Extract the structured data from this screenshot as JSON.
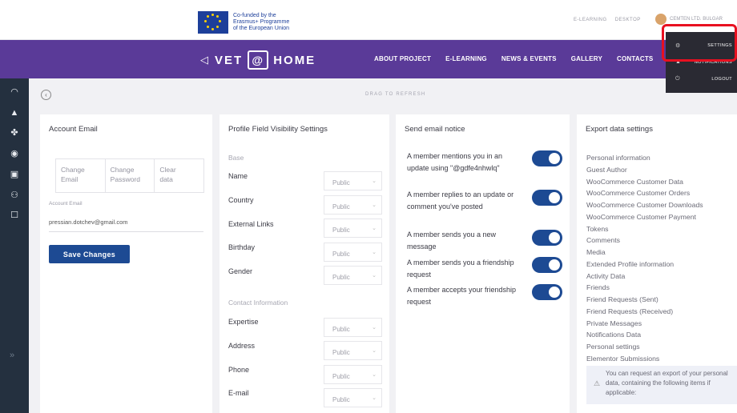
{
  "header": {
    "eu_text": [
      "Co-funded by the",
      "Erasmus+ Programme",
      "of the European Union"
    ],
    "top_links": [
      "E-LEARNING",
      "DESKTOP"
    ],
    "user_name": "CEMTEN LTD. BULGAR"
  },
  "nav": {
    "brand_left": "VET",
    "brand_at": "@",
    "brand_right": "HOME",
    "links": [
      "ABOUT PROJECT",
      "E-LEARNING",
      "NEWS & EVENTS",
      "GALLERY",
      "CONTACTS"
    ]
  },
  "dropdown": {
    "items": [
      {
        "icon": "gear-icon",
        "label": "SETTINGS"
      },
      {
        "icon": "bell-icon",
        "label": "NOTIFICATIONS"
      },
      {
        "icon": "power-icon",
        "label": "LOGOUT"
      }
    ],
    "highlight_color": "#e81020"
  },
  "page": {
    "drag_to_refresh": "DRAG TO REFRESH"
  },
  "account": {
    "title": "Account Email",
    "tabs": [
      {
        "line1": "Change",
        "line2": "Email"
      },
      {
        "line1": "Change",
        "line2": "Password"
      },
      {
        "line1": "Clear",
        "line2": "data"
      }
    ],
    "field_label": "Account Email",
    "email": "pressian.dotchev@gmail.com",
    "save_label": "Save Changes"
  },
  "profile": {
    "title": "Profile Field Visibility Settings",
    "sections": [
      {
        "head": "Base",
        "fields": [
          {
            "name": "Name",
            "value": "Public"
          },
          {
            "name": "Country",
            "value": "Public"
          },
          {
            "name": "External Links",
            "value": "Public"
          },
          {
            "name": "Birthday",
            "value": "Public"
          },
          {
            "name": "Gender",
            "value": "Public"
          }
        ]
      },
      {
        "head": "Contact Information",
        "fields": [
          {
            "name": "Expertise",
            "value": "Public"
          },
          {
            "name": "Address",
            "value": "Public"
          },
          {
            "name": "Phone",
            "value": "Public"
          },
          {
            "name": "E-mail",
            "value": "Public"
          }
        ]
      }
    ]
  },
  "notices": {
    "title": "Send email notice",
    "items": [
      {
        "text": "A member mentions you in an update using \"@gdfe4nhwlq\"",
        "on": true
      },
      {
        "text": "A member replies to an update or comment you've posted",
        "on": true
      },
      {
        "text": "A member sends you a new message",
        "on": true
      },
      {
        "text": "A member sends you a friendship request",
        "on": true
      },
      {
        "text": "A member accepts your friendship request",
        "on": true
      }
    ]
  },
  "export": {
    "title": "Export data settings",
    "items": [
      "Personal information",
      "Guest Author",
      "WooCommerce Customer Data",
      "WooCommerce Customer Orders",
      "WooCommerce Customer Downloads",
      "WooCommerce Customer Payment",
      "Tokens",
      "Comments",
      "Media",
      "Extended Profile information",
      "Activity Data",
      "Friends",
      "Friend Requests (Sent)",
      "Friend Requests (Received)",
      "Private Messages",
      "Notifications Data",
      "Personal settings",
      "Elementor Submissions"
    ],
    "info": "You can request an export of your personal data, containing the following items if applicable:"
  },
  "colors": {
    "nav_purple": "#5a3a98",
    "sidebar": "#24303f",
    "primary_button": "#1d4a93",
    "toggle_on": "#1d4a93"
  }
}
